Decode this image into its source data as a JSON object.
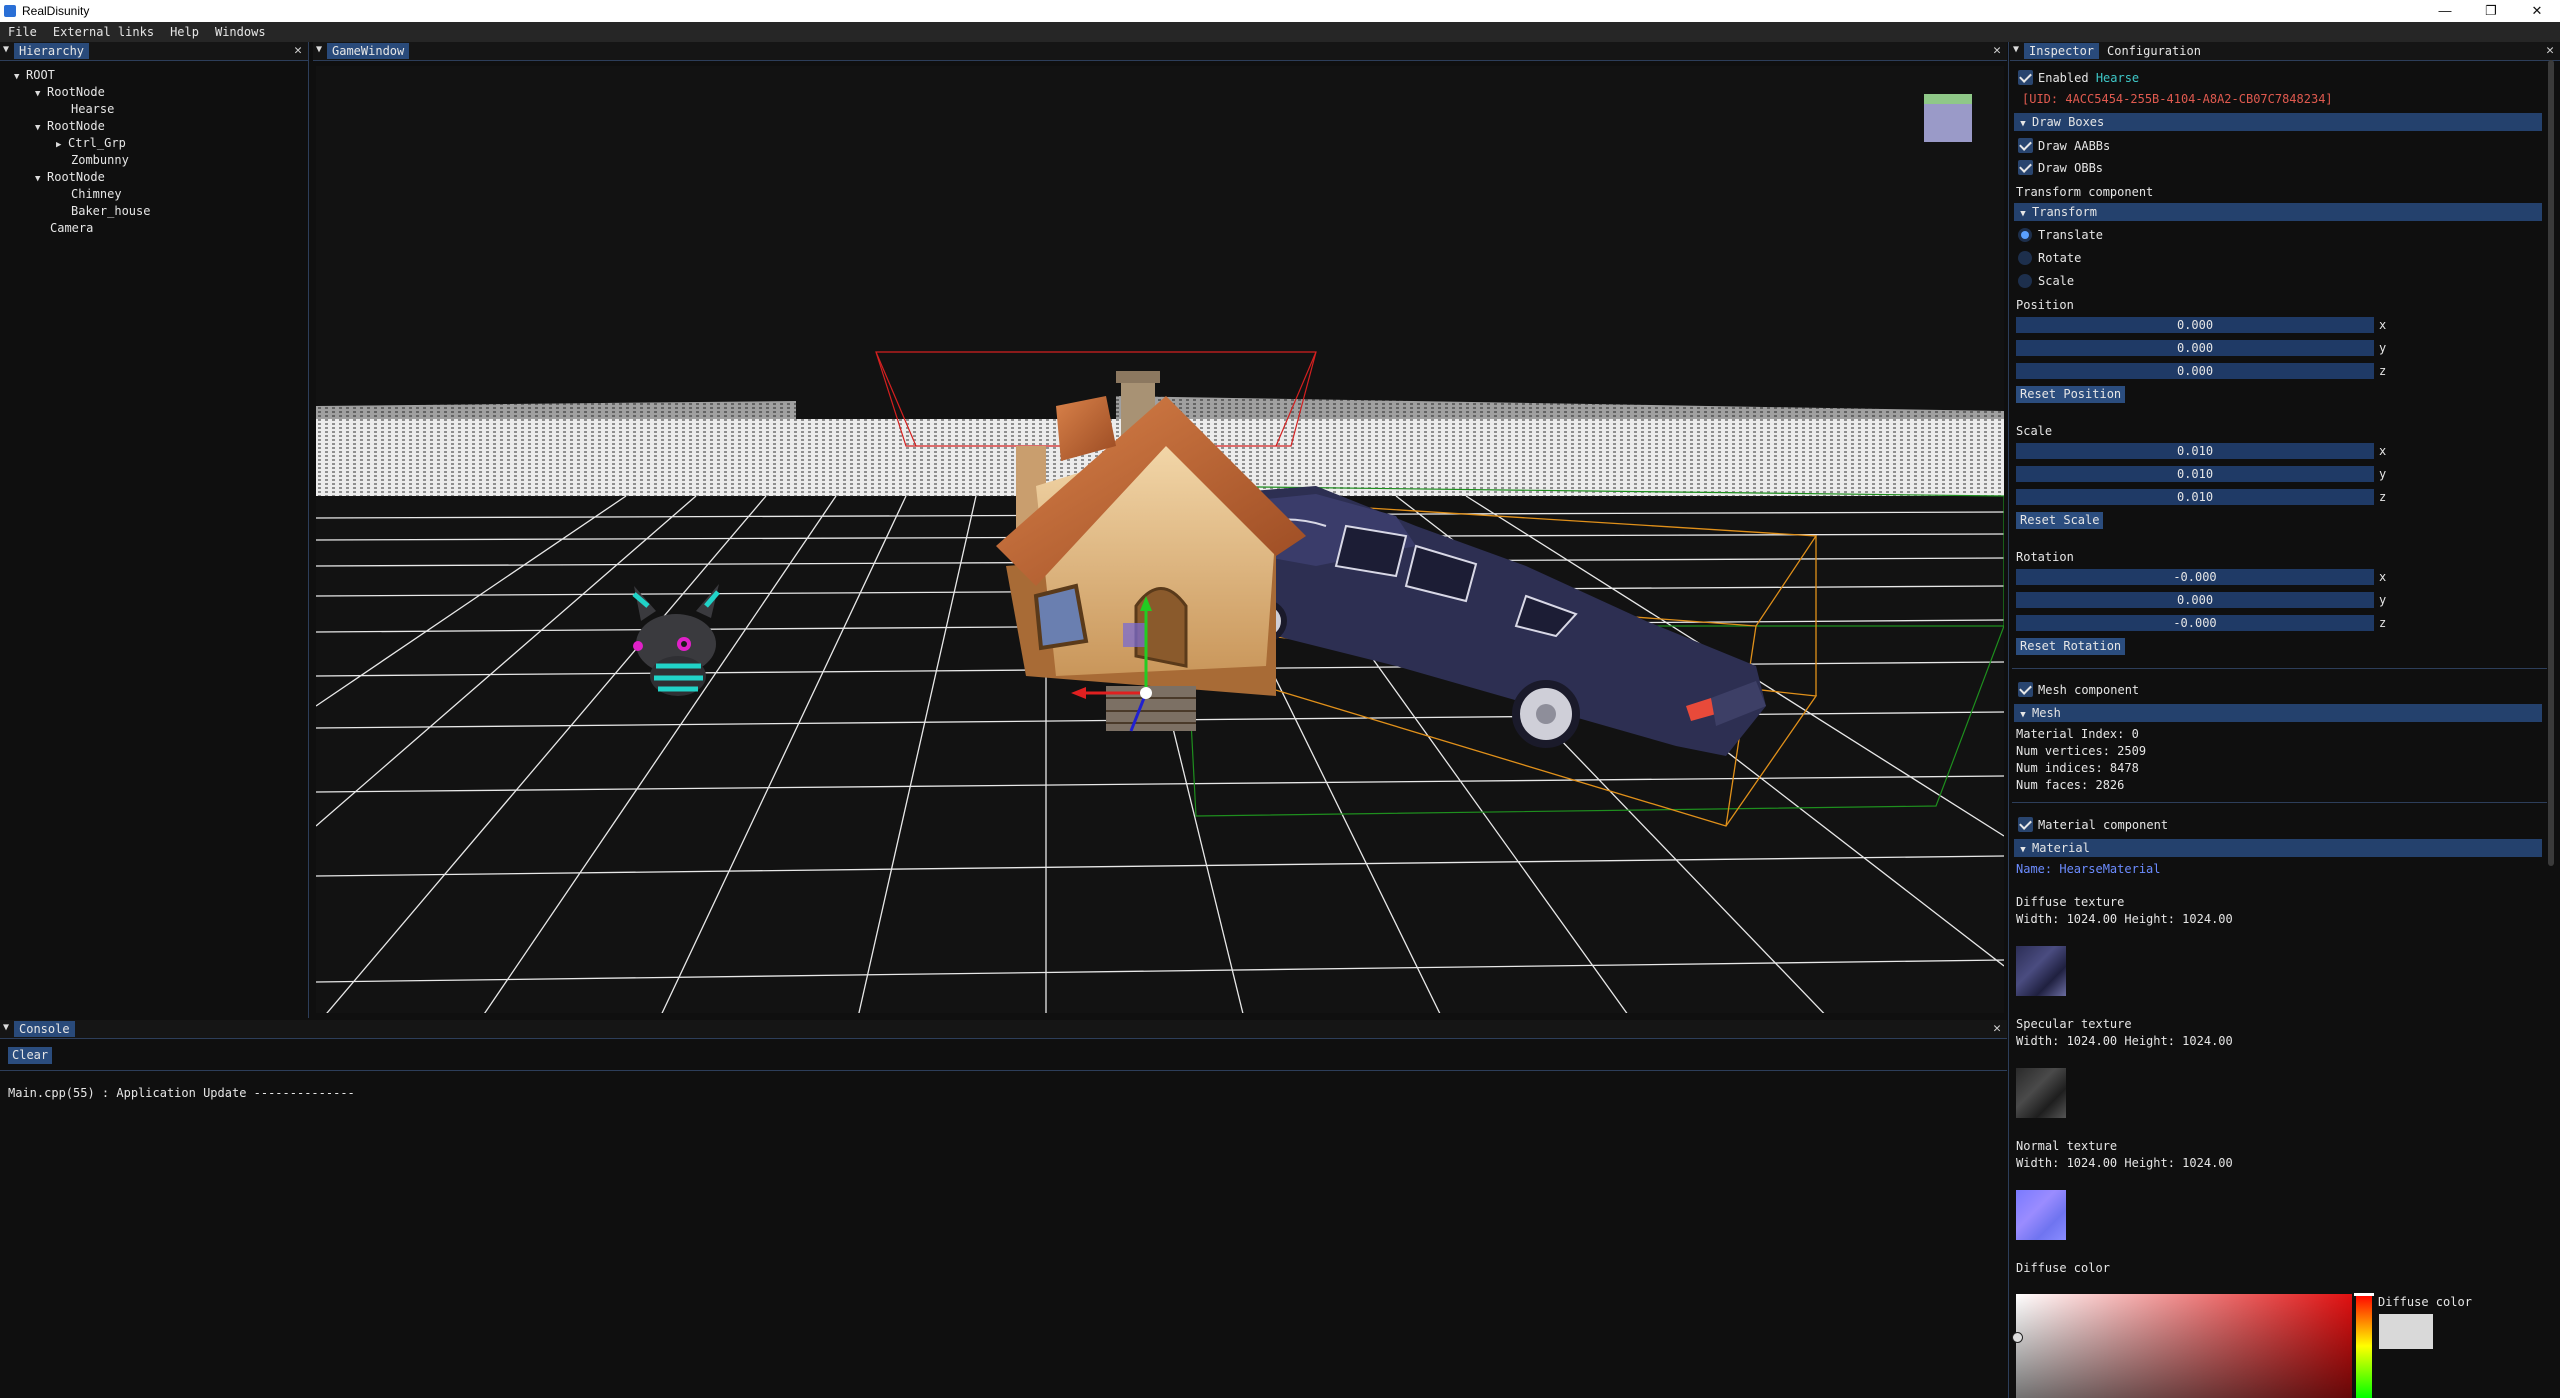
{
  "window": {
    "title": "RealDisunity"
  },
  "menubar": [
    "File",
    "External links",
    "Help",
    "Windows"
  ],
  "hierarchy": {
    "tab": "Hierarchy",
    "nodes": [
      {
        "label": "ROOT",
        "arrow": "▼"
      },
      {
        "label": "RootNode",
        "arrow": "▼"
      },
      {
        "label": "Hearse",
        "arrow": ""
      },
      {
        "label": "RootNode",
        "arrow": "▼"
      },
      {
        "label": "Ctrl_Grp",
        "arrow": "▶"
      },
      {
        "label": "Zombunny",
        "arrow": ""
      },
      {
        "label": "RootNode",
        "arrow": "▼"
      },
      {
        "label": "Chimney",
        "arrow": ""
      },
      {
        "label": "Baker_house",
        "arrow": ""
      },
      {
        "label": "Camera",
        "arrow": ""
      }
    ]
  },
  "game_window": {
    "tab": "GameWindow"
  },
  "console": {
    "tab": "Console",
    "clear_label": "Clear",
    "lines": [
      "Main.cpp(55) : Application Update --------------"
    ]
  },
  "inspector": {
    "tabs": [
      "Inspector",
      "Configuration"
    ],
    "enabled_label": "Enabled",
    "object_name": "Hearse",
    "uid": "[UID: 4ACC5454-255B-4104-A8A2-CB07C7848234]",
    "draw_boxes_header": "Draw Boxes",
    "draw_aabbs": "Draw AABBs",
    "draw_obbs": "Draw OBBs",
    "transform_component": "Transform component",
    "transform_header": "Transform",
    "modes": [
      "Translate",
      "Rotate",
      "Scale"
    ],
    "position_label": "Position",
    "position": [
      "0.000",
      "0.000",
      "0.000"
    ],
    "reset_position": "Reset Position",
    "scale_label": "Scale",
    "scale": [
      "0.010",
      "0.010",
      "0.010"
    ],
    "reset_scale": "Reset Scale",
    "rotation_label": "Rotation",
    "rotation": [
      "-0.000",
      "0.000",
      "-0.000"
    ],
    "reset_rotation": "Reset Rotation",
    "axes": [
      "x",
      "y",
      "z"
    ],
    "mesh_component": "Mesh component",
    "mesh_header": "Mesh",
    "material_index": "Material Index: 0",
    "num_vertices": "Num vertices: 2509",
    "num_indices": "Num indices: 8478",
    "num_faces": "Num faces: 2826",
    "material_component": "Material component",
    "material_header": "Material",
    "material_name": "Name: HearseMaterial",
    "diffuse_texture": "Diffuse texture",
    "diffuse_size": "Width: 1024.00 Height: 1024.00",
    "specular_texture": "Specular texture",
    "specular_size": "Width: 1024.00 Height: 1024.00",
    "normal_texture": "Normal texture",
    "normal_size": "Width: 1024.00 Height: 1024.00",
    "diffuse_color_label": "Diffuse color",
    "diffuse_color_picker_label": "Diffuse color"
  },
  "colors": {
    "accent": "#294a7a",
    "header": "#24416d",
    "uid": "#e05a4f",
    "name_highlight": "#3ec8c8",
    "material_name": "#6c8cff"
  }
}
